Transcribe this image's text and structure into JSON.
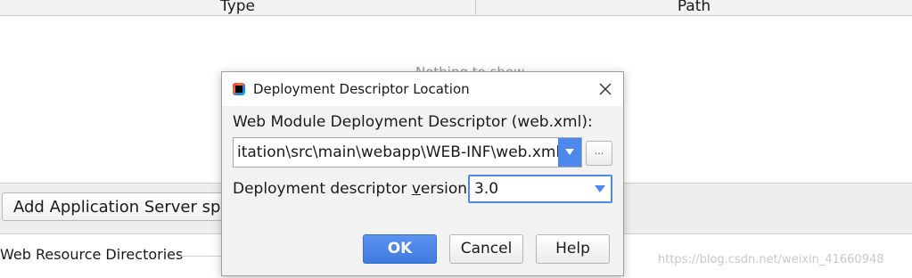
{
  "table": {
    "columns": [
      "Type",
      "Path"
    ],
    "empty_text": "Nothing to show"
  },
  "toolbar": {
    "add_server_label": "Add Application Server spec"
  },
  "sections": {
    "web_resource_title": "Web Resource Directories"
  },
  "watermark": "https://blog.csdn.net/weixin_41660948",
  "dialog": {
    "title": "Deployment Descriptor Location",
    "app_icon": "intellij-idea-icon",
    "close_icon": "close-icon",
    "descriptor_label": "Web Module Deployment Descriptor (web.xml):",
    "descriptor_path": "itation\\src\\main\\webapp\\WEB-INF\\web.xml",
    "browse_label": "...",
    "version_label_prefix": "Deployment descriptor ",
    "version_label_mnemonic": "v",
    "version_label_suffix": "ersion",
    "version_value": "3.0",
    "buttons": {
      "ok": "OK",
      "cancel": "Cancel",
      "help": "Help"
    }
  },
  "colors": {
    "accent": "#4d89ec",
    "ok_button": "#4a84e8",
    "dialog_bg": "#f2f2f2"
  }
}
